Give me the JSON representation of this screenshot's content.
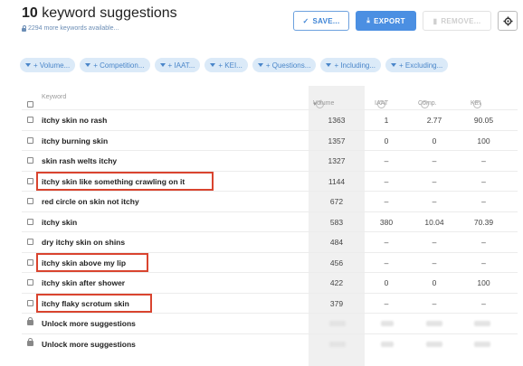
{
  "header": {
    "count": "10",
    "title": "keyword suggestions",
    "more_keywords": "2294 more keywords available..."
  },
  "toolbar": {
    "save_label": "SAVE...",
    "export_label": "EXPORT",
    "remove_label": "REMOVE..."
  },
  "filters": [
    "+ Volume...",
    "+ Competition...",
    "+ IAAT...",
    "+ KEI...",
    "+ Questions...",
    "+ Including...",
    "+ Excluding..."
  ],
  "table": {
    "columns": {
      "keyword": "Keyword",
      "volume": "Volume",
      "iaat": "IAAT",
      "comp": "Comp.",
      "kei": "KEI"
    },
    "rows": [
      {
        "keyword": "itchy skin no rash",
        "volume": "1363",
        "iaat": "1",
        "comp": "2.77",
        "kei": "90.05",
        "highlighted": false
      },
      {
        "keyword": "itchy burning skin",
        "volume": "1357",
        "iaat": "0",
        "comp": "0",
        "kei": "100",
        "highlighted": false
      },
      {
        "keyword": "skin rash welts itchy",
        "volume": "1327",
        "iaat": "–",
        "comp": "–",
        "kei": "–",
        "highlighted": false
      },
      {
        "keyword": "itchy skin like something crawling on it",
        "volume": "1144",
        "iaat": "–",
        "comp": "–",
        "kei": "–",
        "highlighted": true
      },
      {
        "keyword": "red circle on skin not itchy",
        "volume": "672",
        "iaat": "–",
        "comp": "–",
        "kei": "–",
        "highlighted": false
      },
      {
        "keyword": "itchy skin",
        "volume": "583",
        "iaat": "380",
        "comp": "10.04",
        "kei": "70.39",
        "highlighted": false
      },
      {
        "keyword": "dry itchy skin on shins",
        "volume": "484",
        "iaat": "–",
        "comp": "–",
        "kei": "–",
        "highlighted": false
      },
      {
        "keyword": "itchy skin above my lip",
        "volume": "456",
        "iaat": "–",
        "comp": "–",
        "kei": "–",
        "highlighted": true
      },
      {
        "keyword": "itchy skin after shower",
        "volume": "422",
        "iaat": "0",
        "comp": "0",
        "kei": "100",
        "highlighted": false
      },
      {
        "keyword": "itchy flaky scrotum skin",
        "volume": "379",
        "iaat": "–",
        "comp": "–",
        "kei": "–",
        "highlighted": true
      }
    ],
    "locked_rows": [
      {
        "label": "Unlock more suggestions"
      },
      {
        "label": "Unlock more suggestions"
      }
    ]
  },
  "colors": {
    "accent": "#4b8fe2",
    "chip_bg": "#dbeaf8",
    "highlight": "#d9442f"
  }
}
